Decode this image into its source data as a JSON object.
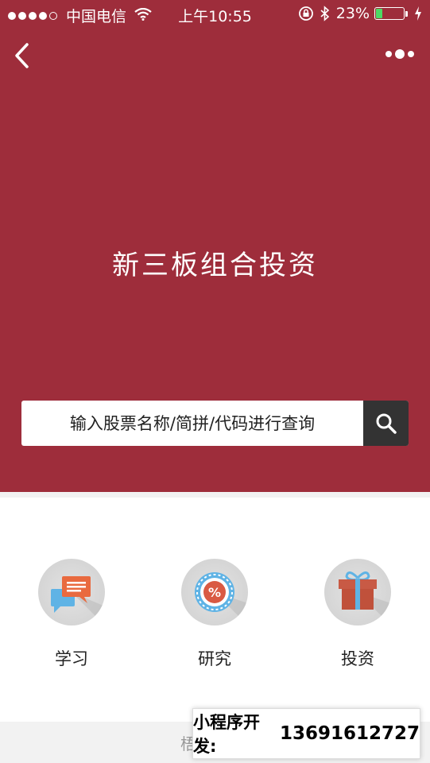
{
  "status_bar": {
    "carrier": "中国电信",
    "time": "上午10:55",
    "battery_percent": "23%",
    "battery_level": 0.23,
    "battery_color": "#4cd964",
    "icons": [
      "signal-dots-icon",
      "wifi-icon",
      "rotation-lock-icon",
      "bluetooth-icon",
      "battery-icon",
      "charging-icon"
    ]
  },
  "nav": {
    "back_icon": "chevron-left-icon",
    "more_icon": "more-dots-icon"
  },
  "hero": {
    "title": "新三板组合投资",
    "background_color": "#9e2d3b"
  },
  "search": {
    "placeholder": "输入股票名称/简拼/代码进行查询",
    "button_icon": "search-icon"
  },
  "features": [
    {
      "label": "学习",
      "icon": "chat-bubbles-icon"
    },
    {
      "label": "研究",
      "icon": "percent-badge-icon"
    },
    {
      "label": "投资",
      "icon": "gift-box-icon"
    }
  ],
  "footer": {
    "partial_text": "梧"
  },
  "promo": {
    "label": "小程序开发:",
    "phone": "13691612727"
  }
}
